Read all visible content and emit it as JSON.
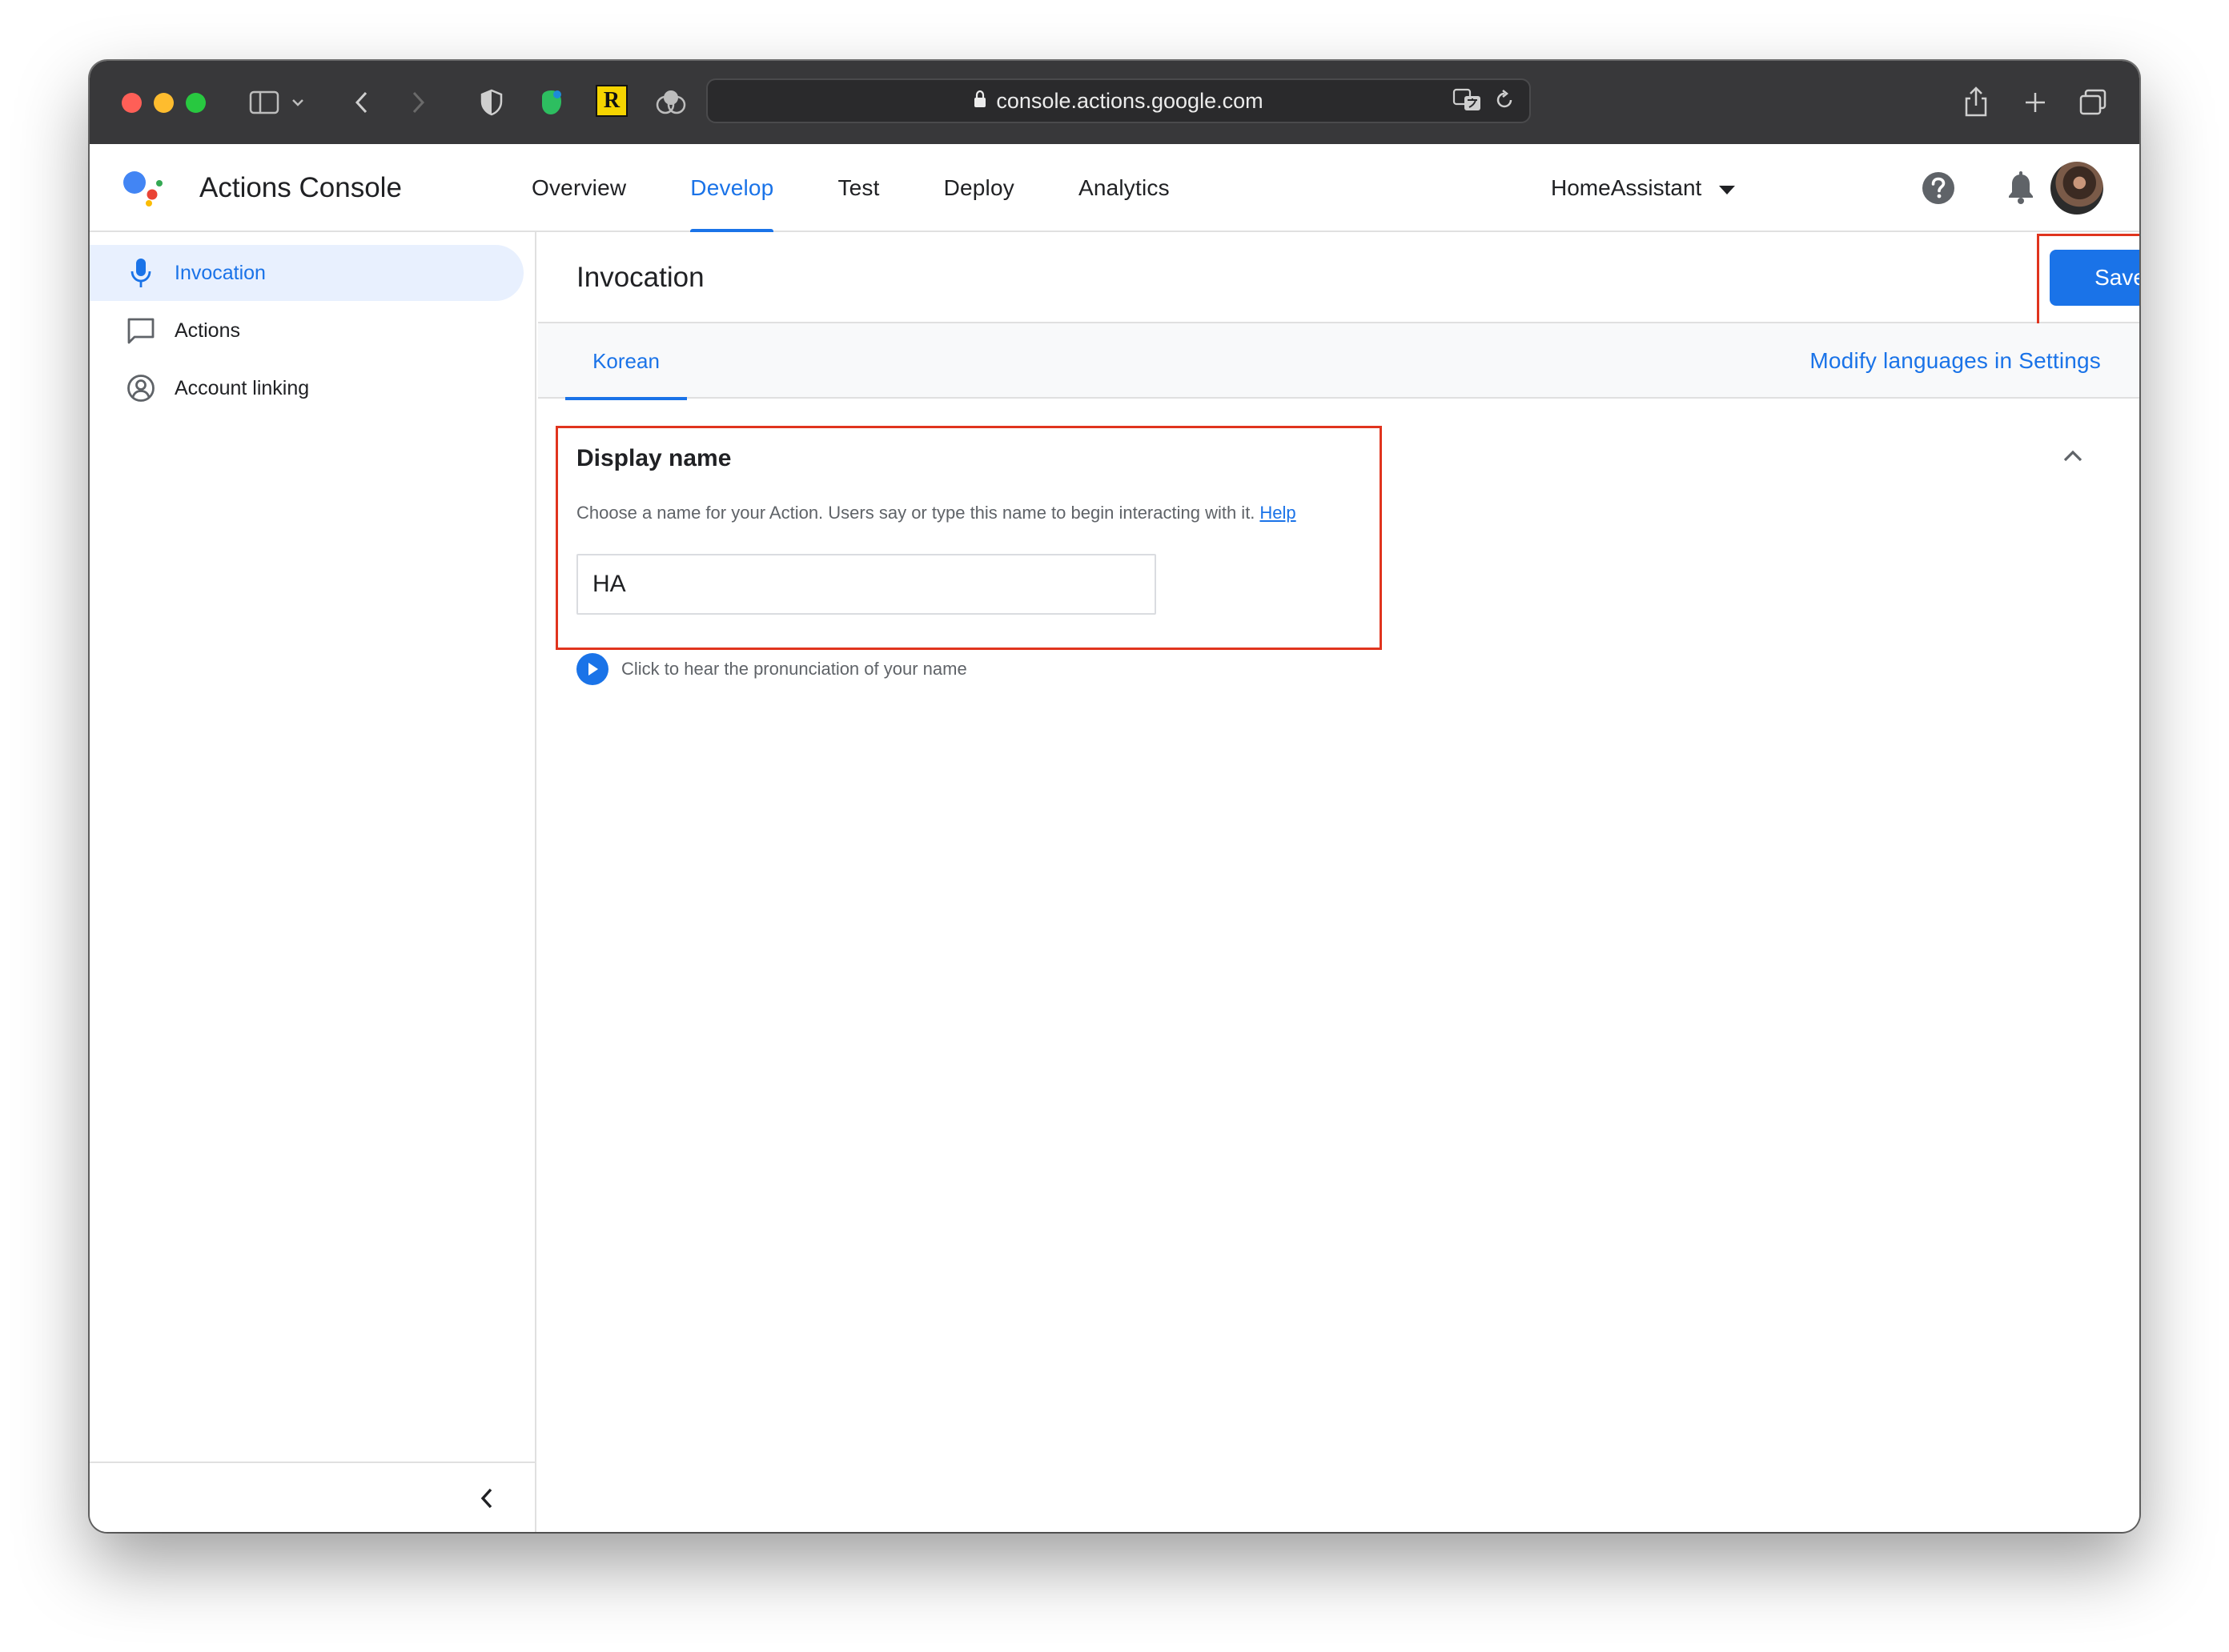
{
  "browser": {
    "url": "console.actions.google.com"
  },
  "app": {
    "title": "Actions Console",
    "nav": [
      "Overview",
      "Develop",
      "Test",
      "Deploy",
      "Analytics"
    ],
    "active_nav": "Develop",
    "project": "HomeAssistant"
  },
  "sidebar": {
    "items": [
      {
        "label": "Invocation",
        "icon": "microphone-icon",
        "active": true
      },
      {
        "label": "Actions",
        "icon": "chat-bubble-icon",
        "active": false
      },
      {
        "label": "Account linking",
        "icon": "account-circle-icon",
        "active": false
      }
    ]
  },
  "page": {
    "title": "Invocation",
    "save_label": "Save",
    "language_tab": "Korean",
    "modify_languages": "Modify languages in Settings",
    "display_name": {
      "title": "Display name",
      "description": "Choose a name for your Action. Users say or type this name to begin interacting with it.",
      "help_link": "Help",
      "value": "HA",
      "pronunciation": "Click to hear the pronunciation of your name"
    }
  },
  "colors": {
    "accent": "#1a73e8",
    "highlight": "#e0341e",
    "toolbar": "#38383a"
  }
}
